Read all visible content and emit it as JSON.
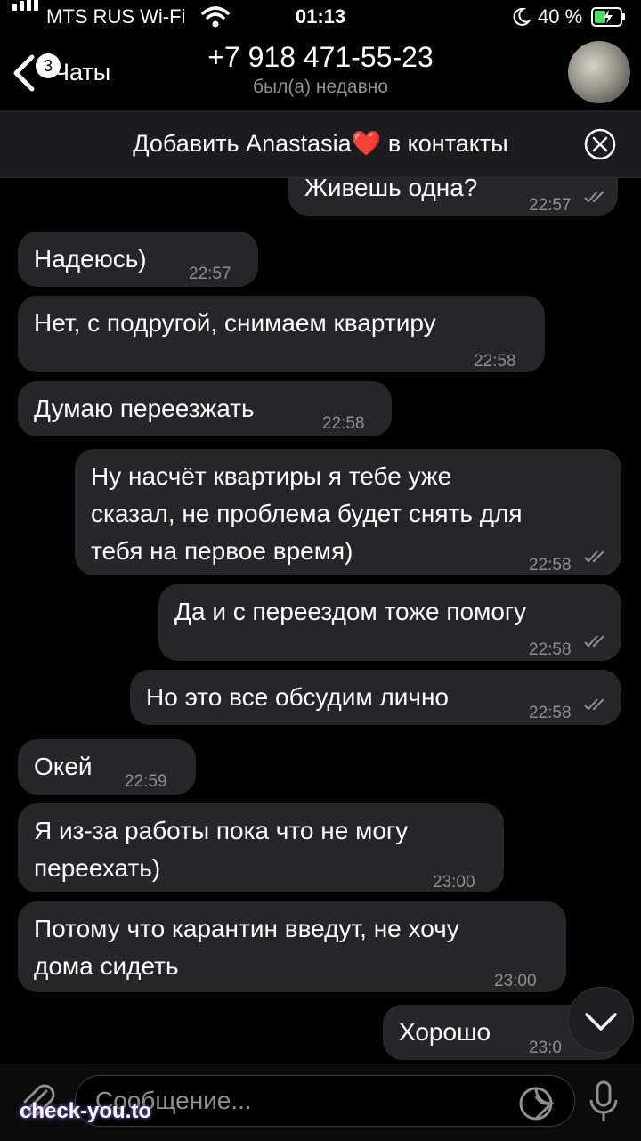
{
  "status": {
    "carrier": "MTS RUS Wi-Fi",
    "time": "01:13",
    "battery": "40 %"
  },
  "header": {
    "back_label": "Чаты",
    "unread_count": "3",
    "title": "+7 918 471-55-23",
    "subtitle": "был(а) недавно"
  },
  "add_contact": {
    "prefix": "Добавить Anastasia",
    "heart": "❤️",
    "suffix": " в контакты"
  },
  "messages": [
    {
      "dir": "out",
      "text": "Живешь одна?",
      "time": "22:57"
    },
    {
      "dir": "in",
      "text": "Надеюсь)",
      "time": "22:57"
    },
    {
      "dir": "in",
      "text": "Нет, с подругой, снимаем квартиру",
      "time": "22:58"
    },
    {
      "dir": "in",
      "text": "Думаю переезжать",
      "time": "22:58"
    },
    {
      "dir": "out",
      "line1": "Ну насчёт квартиры я тебе уже",
      "line2": "сказал, не проблема будет снять для",
      "line3": "тебя на первое время)",
      "time": "22:58"
    },
    {
      "dir": "out",
      "text": "Да и с переездом тоже помогу",
      "time": "22:58"
    },
    {
      "dir": "out",
      "text": "Но это все обсудим лично",
      "time": "22:58"
    },
    {
      "dir": "in",
      "text": "Окей",
      "time": "22:59"
    },
    {
      "dir": "in",
      "line1": "Я из-за работы пока что не могу",
      "line2": "переехать)",
      "time": "23:00"
    },
    {
      "dir": "in",
      "line1": "Потому что карантин введут, не хочу",
      "line2": "дома сидеть",
      "time": "23:00"
    },
    {
      "dir": "out",
      "text": "Хорошо",
      "time": "23:0"
    }
  ],
  "input": {
    "placeholder": "Сообщение..."
  },
  "watermark": "check-you.to",
  "colors": {
    "bubble": "#262628",
    "background": "#000000",
    "time": "#8e8e93"
  }
}
